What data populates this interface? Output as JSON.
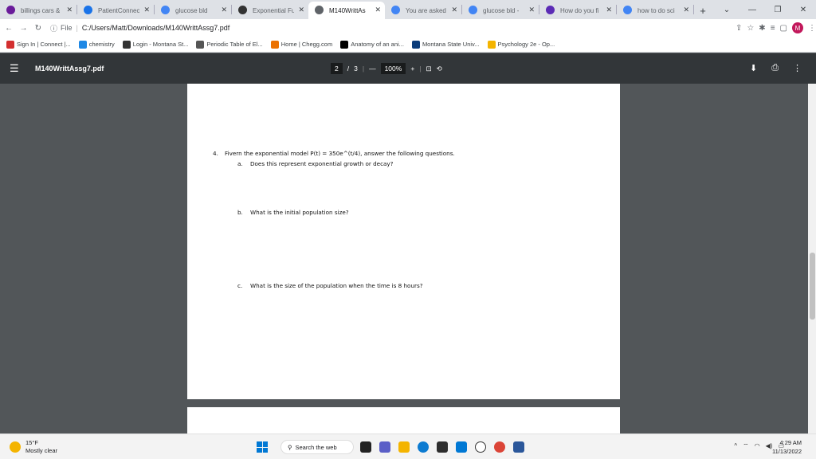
{
  "tabs": [
    {
      "label": "billings cars &",
      "icon": "purple-circle-icon",
      "color": "#6a1b9a",
      "active": false
    },
    {
      "label": "PatientConnec",
      "icon": "patientconnect-icon",
      "color": "#1a73e8",
      "active": false
    },
    {
      "label": "glucose bld",
      "icon": "google-icon",
      "color": "#4285f4",
      "active": false
    },
    {
      "label": "Exponential Fu",
      "icon": "pdf-icon",
      "color": "#333333",
      "active": false
    },
    {
      "label": "M140WrittAs",
      "icon": "chrome-icon",
      "color": "#5f6368",
      "active": true
    },
    {
      "label": "You are asked",
      "icon": "google-icon",
      "color": "#4285f4",
      "active": false
    },
    {
      "label": "glucose bld -",
      "icon": "google-icon",
      "color": "#4285f4",
      "active": false
    },
    {
      "label": "How do you fi",
      "icon": "socratic-icon",
      "color": "#5b2bb5",
      "active": false
    },
    {
      "label": "how to do sci",
      "icon": "google-icon",
      "color": "#4285f4",
      "active": false
    }
  ],
  "omnibox": {
    "scheme": "File",
    "url": "C:/Users/Matt/Downloads/M140WrittAssg7.pdf"
  },
  "bookmarks": [
    {
      "label": "Sign In | Connect |...",
      "icon": "connect-icon",
      "color": "#d32f2f"
    },
    {
      "label": "chemistry",
      "icon": "chemistry-icon",
      "color": "#1e88e5"
    },
    {
      "label": "Login - Montana St...",
      "icon": "d2l-icon",
      "color": "#333333"
    },
    {
      "label": "Periodic Table of El...",
      "icon": "periodic-icon",
      "color": "#555555"
    },
    {
      "label": "Home | Chegg.com",
      "icon": "chegg-icon",
      "color": "#eb7100"
    },
    {
      "label": "Anatomy of an ani...",
      "icon": "anatomy-icon",
      "color": "#000000"
    },
    {
      "label": "Montana State Univ...",
      "icon": "msu-icon",
      "color": "#0b3c7a"
    },
    {
      "label": "Psychology 2e - Op...",
      "icon": "openstax-icon",
      "color": "#f4b400"
    }
  ],
  "pdf": {
    "title": "M140WrittAssg7.pdf",
    "page_current": "2",
    "page_separator": "/",
    "page_total": "3",
    "zoom": "100%"
  },
  "document": {
    "q4_number": "4.",
    "q4_text": "Fivern the exponential model P(t) = 350e^(t/4), answer the following questions.",
    "q4a_label": "a.",
    "q4a_text": "Does this represent exponential growth or decay?",
    "q4b_label": "b.",
    "q4b_text": "What is the initial population size?",
    "q4c_label": "c.",
    "q4c_text": "What is the size of the population when the time is 8 hours?"
  },
  "taskbar": {
    "temperature": "15°F",
    "weather": "Mostly clear",
    "search_placeholder": "Search the web",
    "time": "4:29 AM",
    "date": "11/13/2022"
  },
  "profile_initial": "M"
}
